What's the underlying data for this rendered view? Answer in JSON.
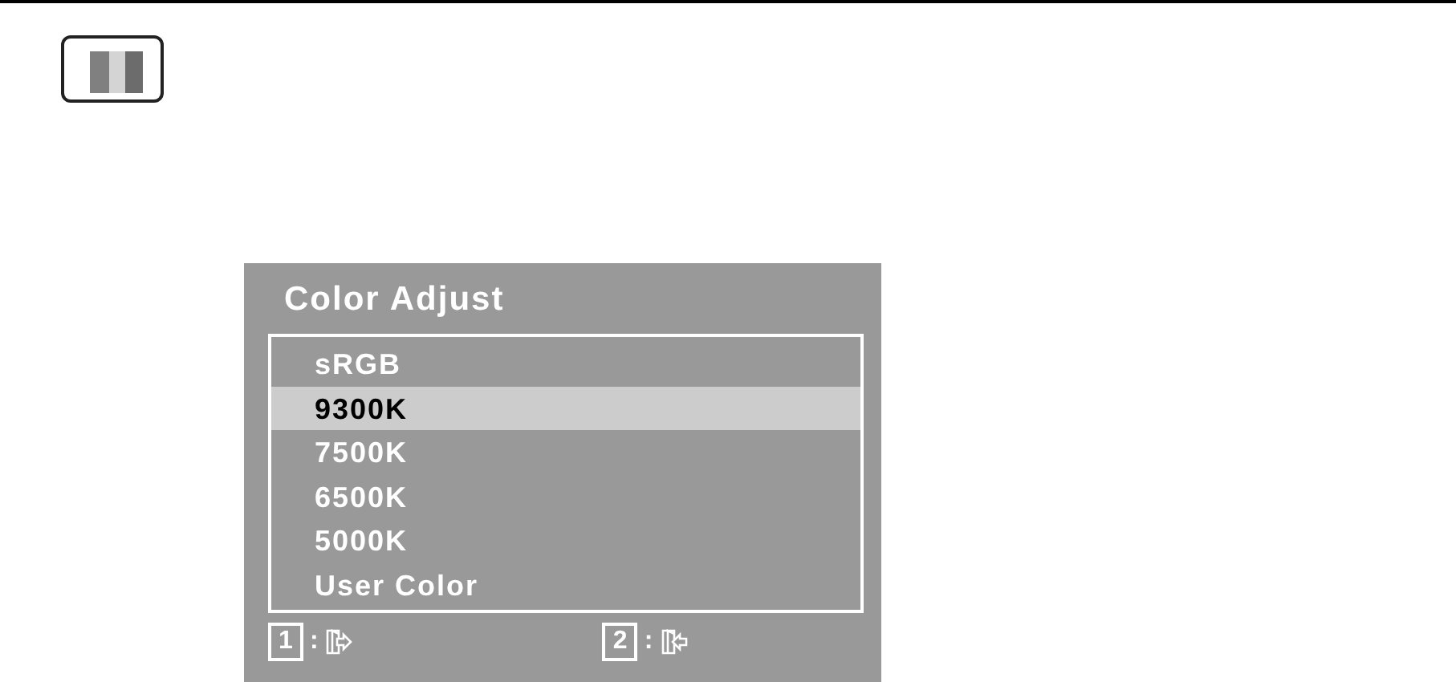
{
  "osd": {
    "title": "Color Adjust",
    "items": [
      {
        "label": "sRGB",
        "selected": false
      },
      {
        "label": "9300K",
        "selected": true
      },
      {
        "label": "7500K",
        "selected": false
      },
      {
        "label": "6500K",
        "selected": false
      },
      {
        "label": "5000K",
        "selected": false
      },
      {
        "label": "User Color",
        "selected": false
      }
    ],
    "footer": [
      {
        "key": "1",
        "separator": ":",
        "kind": "exit"
      },
      {
        "key": "2",
        "separator": ":",
        "kind": "enter"
      }
    ]
  }
}
